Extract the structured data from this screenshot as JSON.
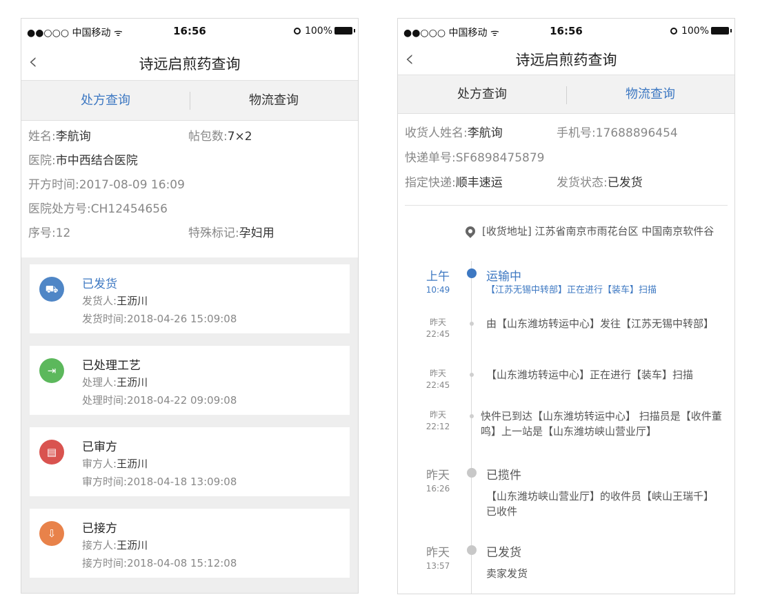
{
  "status_bar": {
    "carrier": "●●○○○ 中国移动 ᯤ",
    "time": "16:56",
    "battery": "100%"
  },
  "left": {
    "title": "诗远启煎药查询",
    "tabs": [
      "处方查询",
      "物流查询"
    ],
    "info": {
      "name_k": "姓名:",
      "name_v": "李航询",
      "packs_k": "帖包数:",
      "packs_v": "7×2",
      "hospital_k": "医院:",
      "hospital_v": "市中西结合医院",
      "time_k": "开方时间:",
      "time_v": "2017-08-09 16:09",
      "rx_k": "医院处方号:",
      "rx_v": "CH12454656",
      "seq_k": "序号:",
      "seq_v": "12",
      "mark_k": "特殊标记:",
      "mark_v": "孕妇用"
    },
    "cards": [
      {
        "title": "已发货",
        "person_k": "发货人:",
        "person_v": "王沥川",
        "time_k": "发货时间:",
        "time_v": "2018-04-26 15:09:08",
        "color": "#4f86c6",
        "icon": "⛟"
      },
      {
        "title": "已处理工艺",
        "person_k": "处理人:",
        "person_v": "王沥川",
        "time_k": "处理时间:",
        "time_v": "2018-04-22 09:09:08",
        "color": "#5cb85c",
        "icon": "⇥"
      },
      {
        "title": "已审方",
        "person_k": "审方人:",
        "person_v": "王沥川",
        "time_k": "审方时间:",
        "time_v": "2018-04-18 13:09:08",
        "color": "#d9534f",
        "icon": "▤"
      },
      {
        "title": "已接方",
        "person_k": "接方人:",
        "person_v": "王沥川",
        "time_k": "接方时间:",
        "time_v": "2018-04-08 15:12:08",
        "color": "#e8824a",
        "icon": "⇩"
      }
    ]
  },
  "right": {
    "title": "诗远启煎药查询",
    "tabs": [
      "处方查询",
      "物流查询"
    ],
    "info": {
      "receiver_k": "收货人姓名:",
      "receiver_v": "李航询",
      "phone_k": "手机号:",
      "phone_v": "17688896454",
      "tracking_k": "快递单号:",
      "tracking_v": "SF6898475879",
      "courier_k": "指定快递:",
      "courier_v": "顺丰速运",
      "ship_k": "发货状态:",
      "ship_v": "已发货"
    },
    "address": "[收货地址] 江苏省南京市雨花台区 中国南京软件谷",
    "events": [
      {
        "t1": "上午",
        "t2": "10:49",
        "title": "运输中",
        "desc": "【江苏无锡中转部】正在进行【装车】扫描"
      },
      {
        "t1": "昨天",
        "t2": "22:45",
        "desc": "由【山东潍坊转运中心】发往【江苏无锡中转部】"
      },
      {
        "t1": "昨天",
        "t2": "22:45",
        "desc": "【山东潍坊转运中心】正在进行【装车】扫描"
      },
      {
        "t1": "昨天",
        "t2": "22:12",
        "desc": "快件已到达【山东潍坊转运中心】 扫描员是【收件董鸣】上一站是【山东潍坊峡山营业厅】"
      },
      {
        "t1": "昨天",
        "t2": "16:26",
        "title": "已揽件",
        "desc": "【山东潍坊峡山营业厅】的收件员【峡山王瑞千】已收件"
      },
      {
        "t1": "昨天",
        "t2": "13:57",
        "title": "已发货",
        "desc": "卖家发货"
      }
    ]
  }
}
